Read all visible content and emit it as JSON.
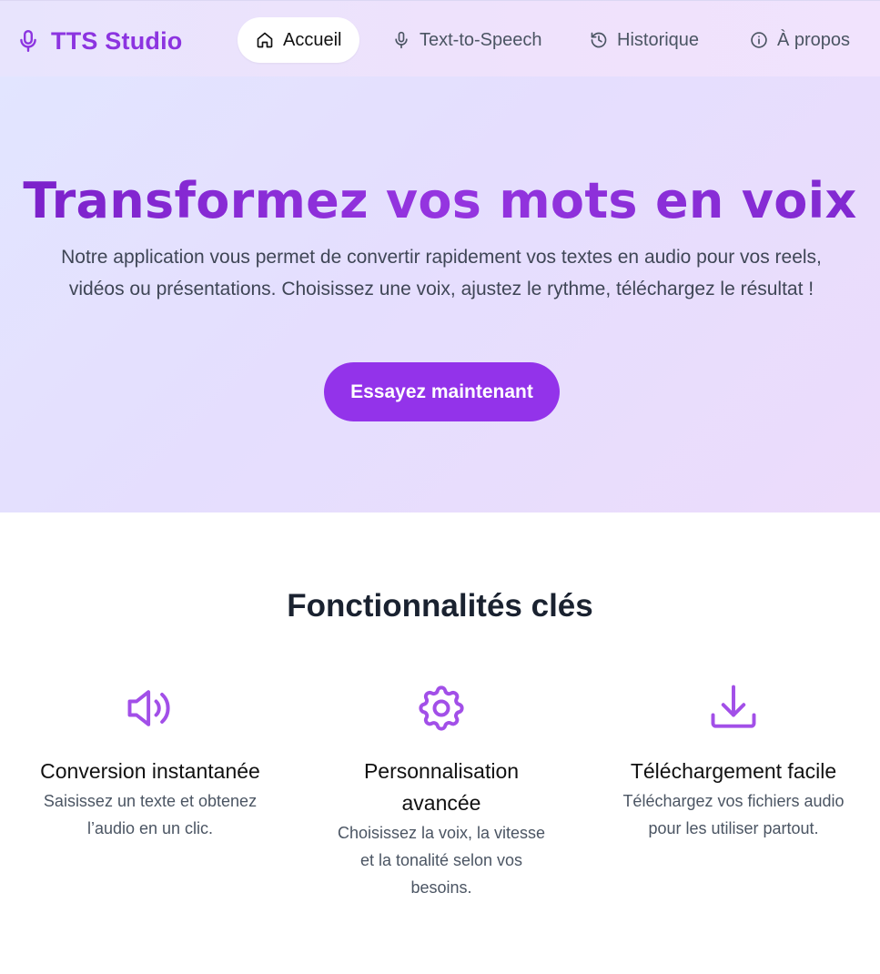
{
  "brand": {
    "name": "TTS Studio",
    "icon": "microphone-icon",
    "color": "#8c34e0"
  },
  "nav": {
    "items": [
      {
        "label": "Accueil",
        "icon": "home-icon",
        "active": true
      },
      {
        "label": "Text-to-Speech",
        "icon": "microphone-icon",
        "active": false
      },
      {
        "label": "Historique",
        "icon": "history-icon",
        "active": false
      },
      {
        "label": "À propos",
        "icon": "info-icon",
        "active": false
      }
    ]
  },
  "hero": {
    "title": "Transformez vos mots en voix",
    "subtitle": "Notre application vous permet de convertir rapidement vos textes en audio pour vos reels, vidéos ou présentations. Choisissez une voix, ajustez le rythme, téléchargez le résultat !",
    "cta_label": "Essayez maintenant",
    "accent_color": "#9333ea"
  },
  "features": {
    "title": "Fonctionnalités clés",
    "items": [
      {
        "icon": "speaker-icon",
        "title": "Conversion instantanée",
        "description": "Saisissez un texte et obtenez l’audio en un clic."
      },
      {
        "icon": "gear-icon",
        "title": "Personnalisation avancée",
        "description": "Choisissez la voix, la vitesse et la tonalité selon vos besoins."
      },
      {
        "icon": "download-icon",
        "title": "Téléchargement facile",
        "description": "Téléchargez vos fichiers audio pour les utiliser partout."
      }
    ]
  }
}
